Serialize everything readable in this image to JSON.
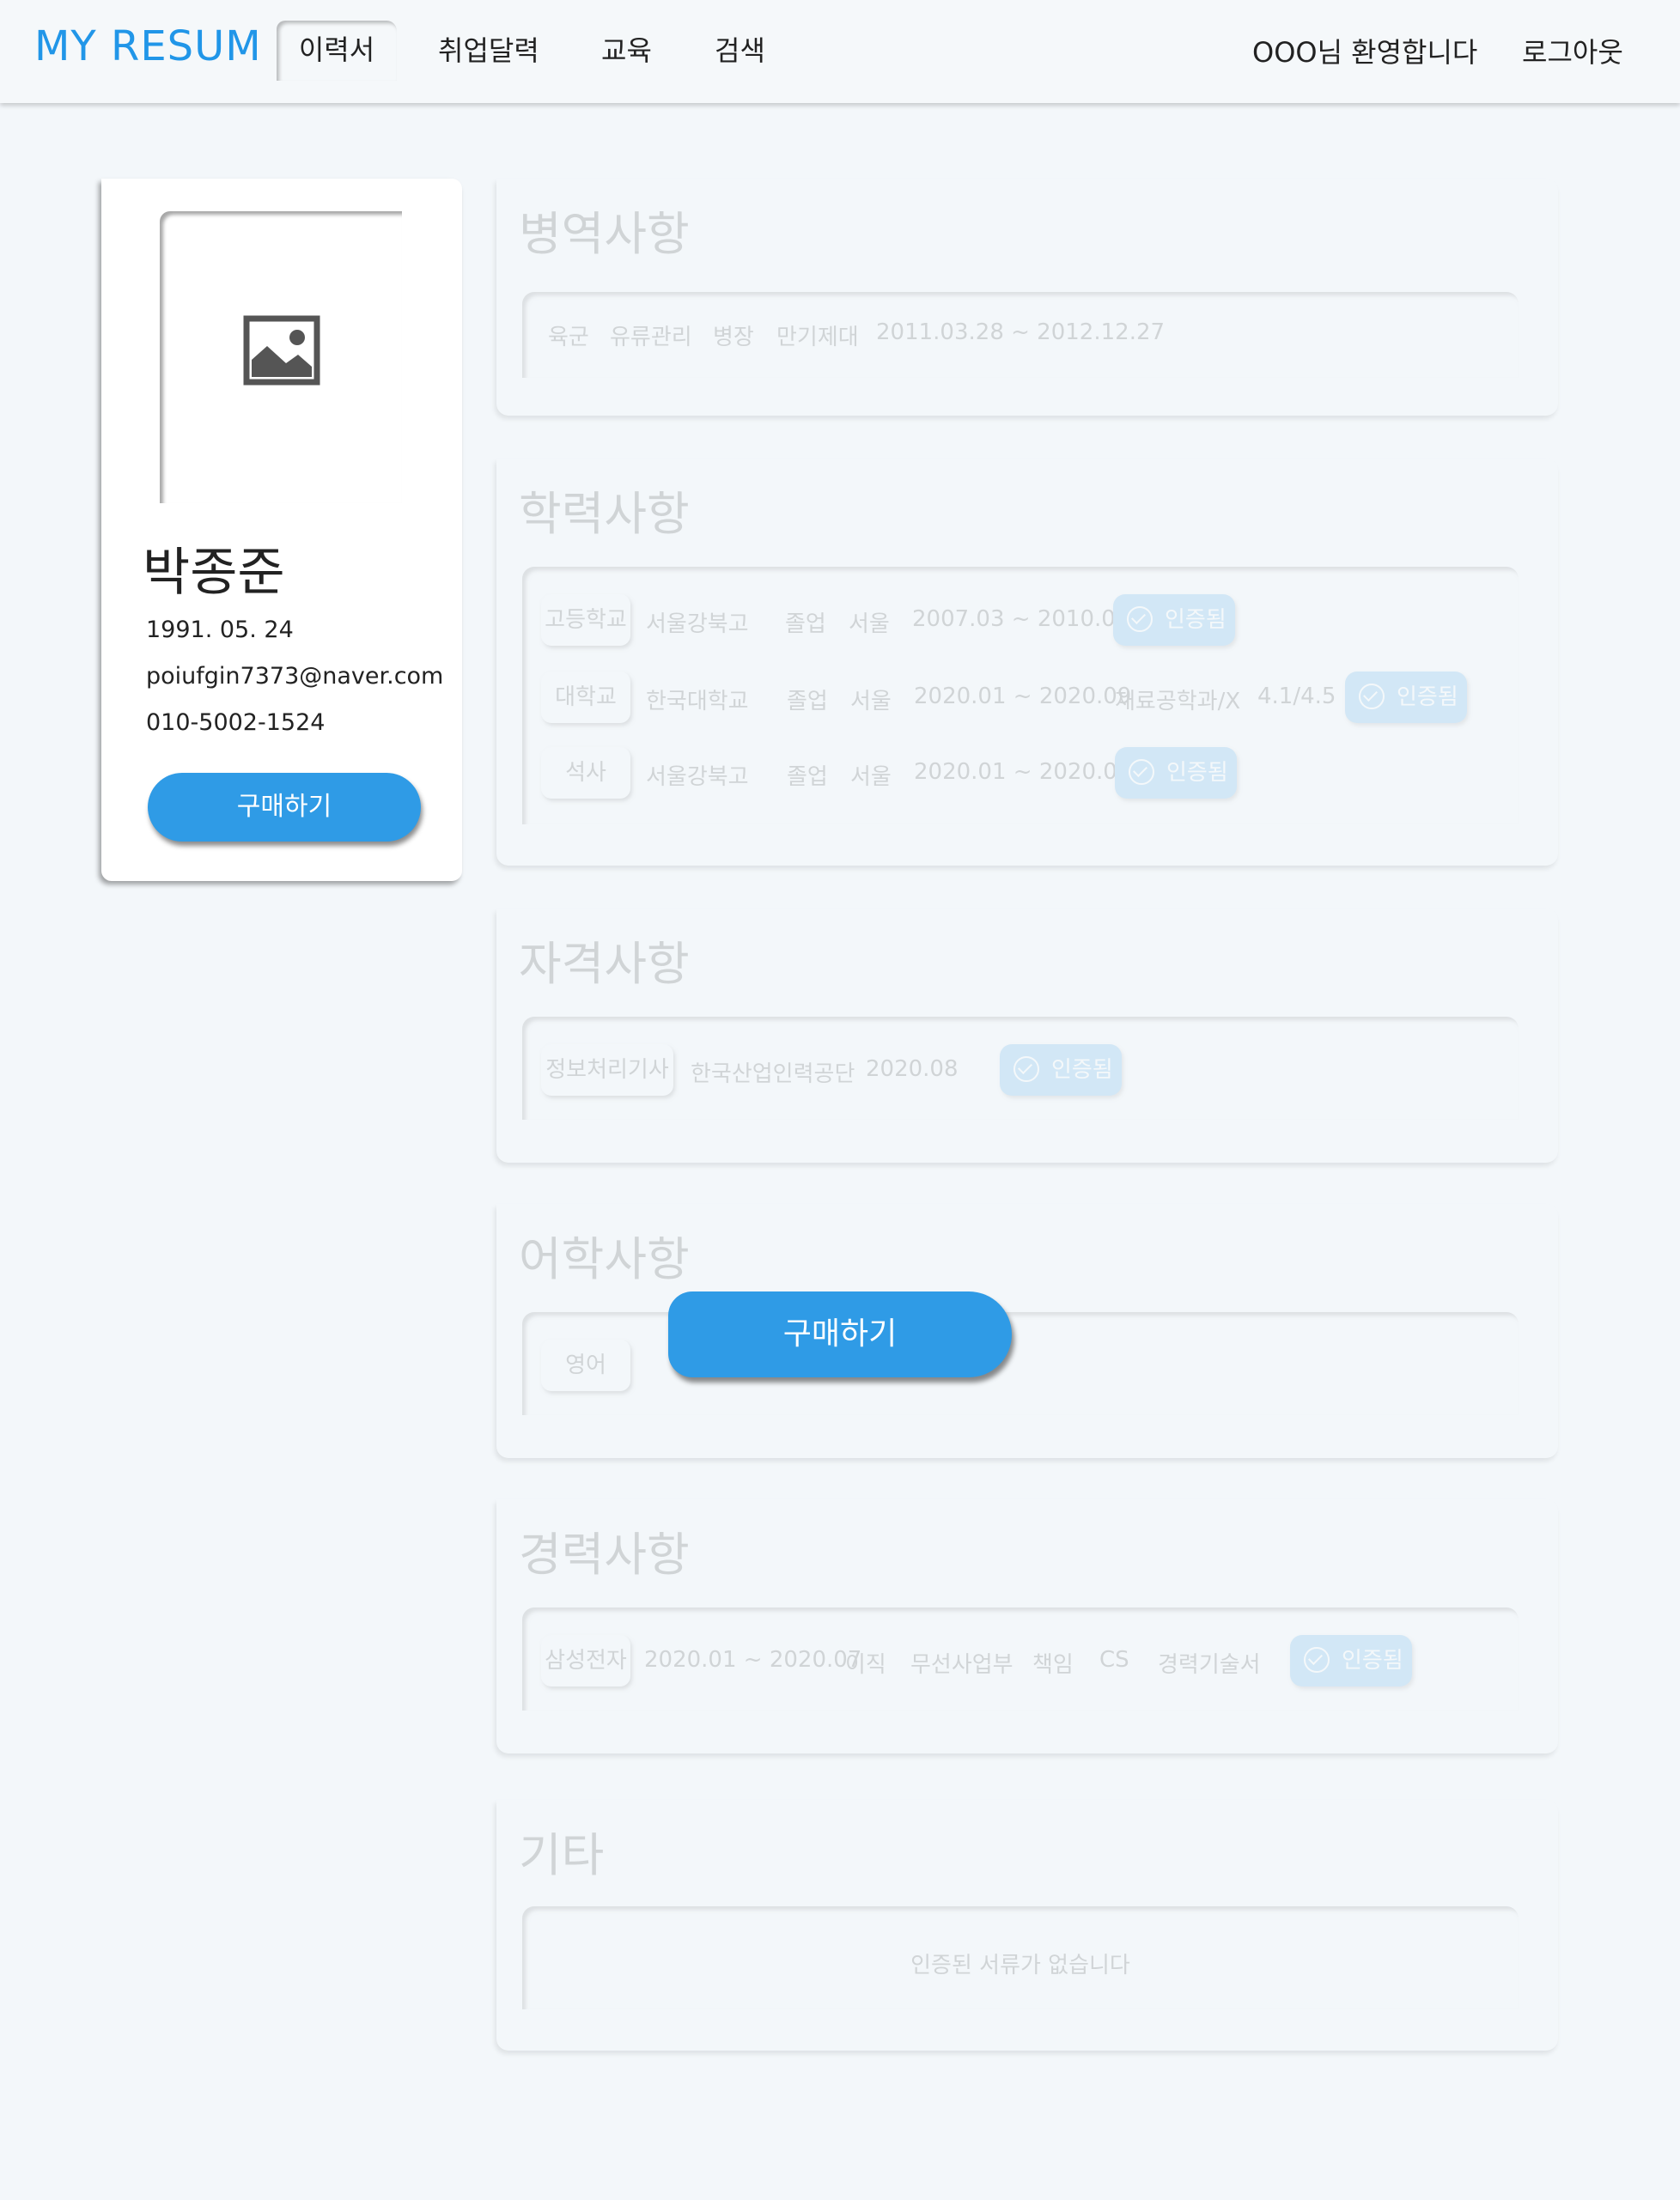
{
  "header": {
    "logo": "MY RESUM",
    "tabs": [
      {
        "label": "이력서",
        "active": true
      },
      {
        "label": "취업달력"
      },
      {
        "label": "교육"
      },
      {
        "label": "검색"
      }
    ],
    "welcome": "OOO님 환영합니다",
    "logout": "로그아웃"
  },
  "profile": {
    "photo_icon": "image-placeholder-icon",
    "name": "박종준",
    "birth": "1991. 05. 24",
    "email": "poiufgin7373@naver.com",
    "phone": "010-5002-1524",
    "buy_label": "구매하기"
  },
  "sections": {
    "military": {
      "title": "병역사항",
      "fields": [
        "육군",
        "유류관리",
        "병장",
        "만기제대",
        "2011.03.28 ~ 2012.12.27"
      ]
    },
    "education": {
      "title": "학력사항",
      "rows": [
        {
          "level": "고등학교",
          "school": "서울강북고",
          "status": "졸업",
          "region": "서울",
          "period": "2007.03 ~ 2010.02",
          "badge": "인증됨"
        },
        {
          "level": "대학교",
          "school": "한국대학교",
          "status": "졸업",
          "region": "서울",
          "period": "2020.01 ~ 2020.09",
          "major": "재료공학과/X",
          "gpa": "4.1/4.5",
          "badge": "인증됨"
        },
        {
          "level": "석사",
          "school": "서울강북고",
          "status": "졸업",
          "region": "서울",
          "period": "2020.01 ~ 2020.09",
          "badge": "인증됨"
        }
      ]
    },
    "certificates": {
      "title": "자격사항",
      "rows": [
        {
          "name": "정보처리기사",
          "issuer": "한국산업인력공단",
          "date": "2020.08",
          "badge": "인증됨"
        }
      ]
    },
    "language": {
      "title": "어학사항",
      "rows": [
        {
          "lang": "영어"
        }
      ]
    },
    "career": {
      "title": "경력사항",
      "rows": [
        {
          "company": "삼성전자",
          "period": "2020.01 ~ 2020.07",
          "status": "이직",
          "dept": "무선사업부",
          "rank": "책임",
          "duty": "CS",
          "doc": "경력기술서",
          "badge": "인증됨"
        }
      ]
    },
    "etc": {
      "title": "기타",
      "empty": "인증된 서류가 없습니다"
    }
  },
  "overlay": {
    "buy_label": "구매하기"
  },
  "colors": {
    "accent": "#2f9be6",
    "logo": "#2196e8",
    "background": "#f3f7fa"
  }
}
